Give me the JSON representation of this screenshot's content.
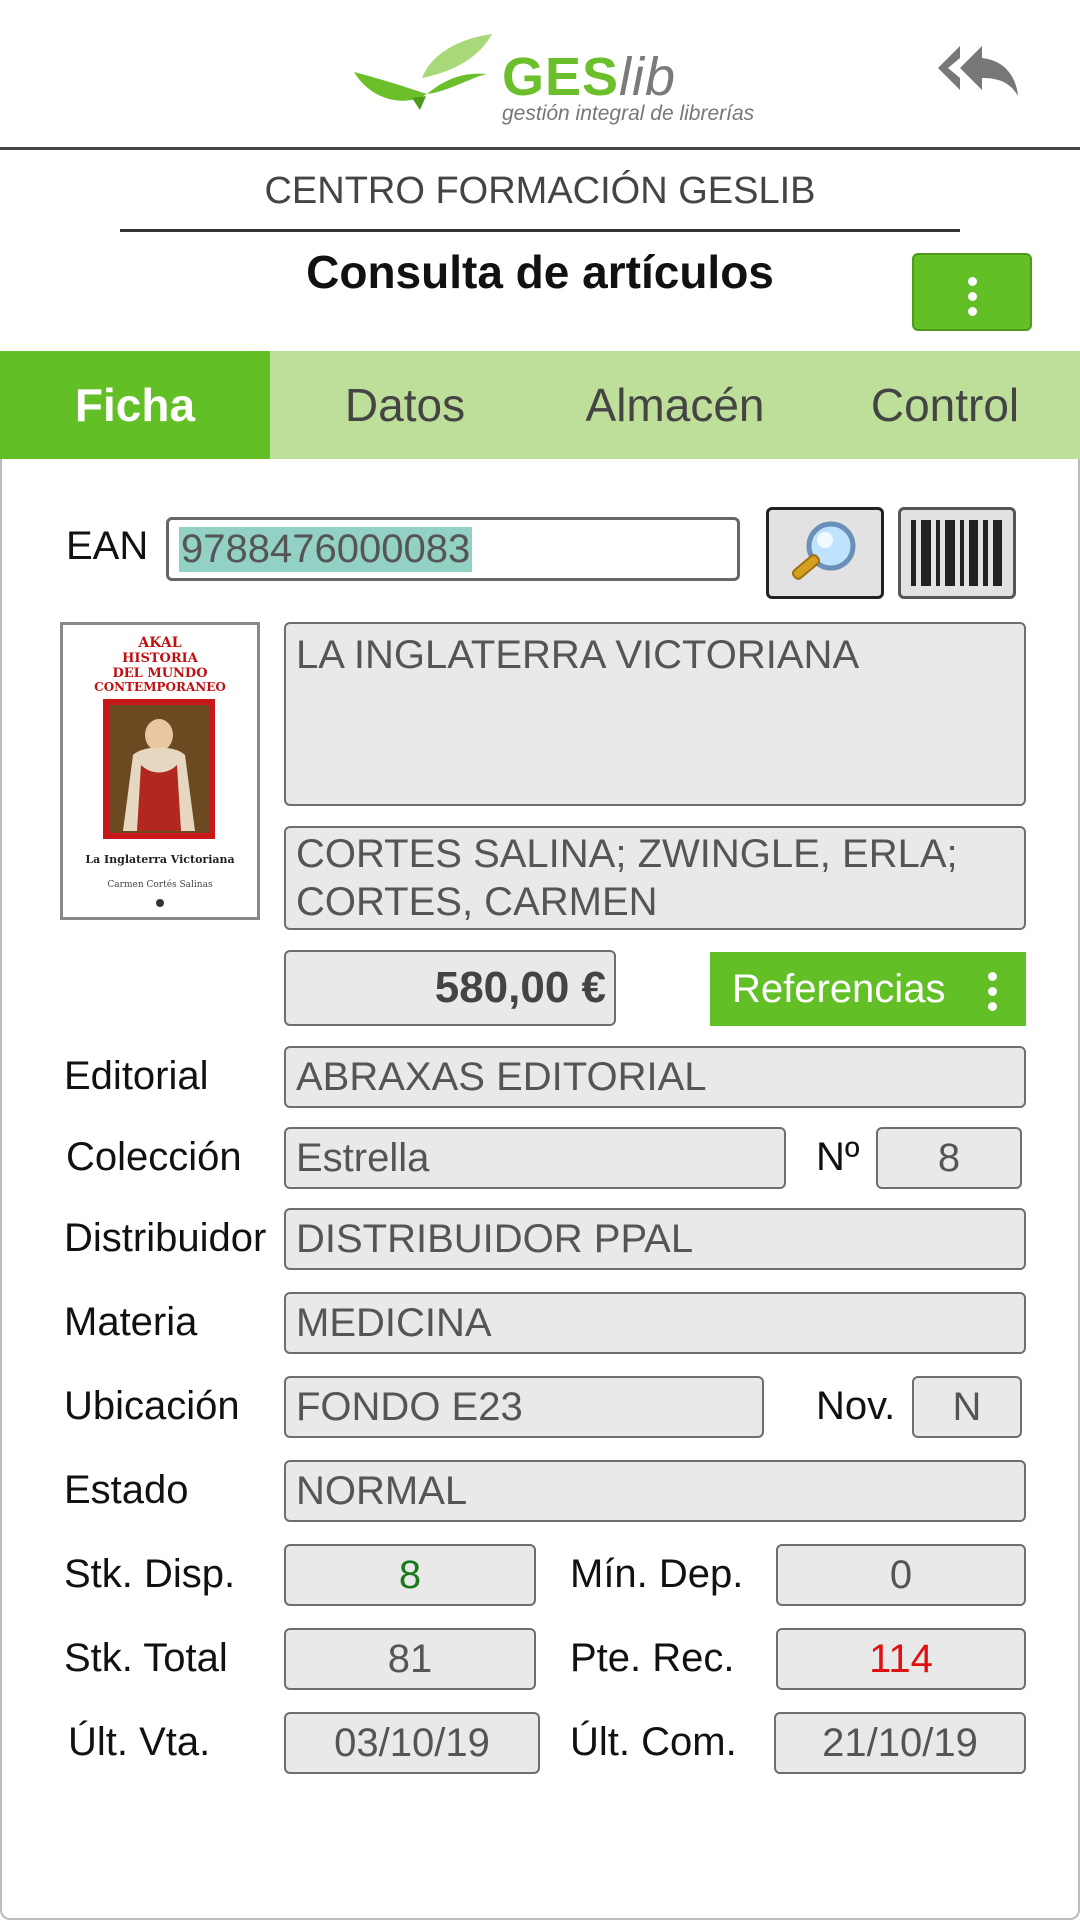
{
  "header": {
    "logo_word_a": "GES",
    "logo_word_b": "lib",
    "logo_tagline": "gestión integral de librerías",
    "center_name": "CENTRO FORMACIÓN GESLIB",
    "page_title": "Consulta de artículos"
  },
  "tabs": [
    {
      "label": "Ficha",
      "active": true
    },
    {
      "label": "Datos",
      "active": false
    },
    {
      "label": "Almacén",
      "active": false
    },
    {
      "label": "Control",
      "active": false
    }
  ],
  "form": {
    "ean_label": "EAN",
    "ean_value": "9788476000083",
    "title": "LA INGLATERRA VICTORIANA",
    "author": "CORTES SALINA; ZWINGLE, ERLA; CORTES, CARMEN",
    "price": "580,00 €",
    "referencias_label": "Referencias",
    "editorial_label": "Editorial",
    "editorial_value": "ABRAXAS EDITORIAL",
    "coleccion_label": "Colección",
    "coleccion_value": "Estrella",
    "numero_label": "Nº",
    "numero_value": "8",
    "distribuidor_label": "Distribuidor",
    "distribuidor_value": "DISTRIBUIDOR PPAL",
    "materia_label": "Materia",
    "materia_value": "MEDICINA",
    "ubicacion_label": "Ubicación",
    "ubicacion_value": "FONDO E23",
    "nov_label": "Nov.",
    "nov_value": "N",
    "estado_label": "Estado",
    "estado_value": "NORMAL",
    "stk_disp_label": "Stk. Disp.",
    "stk_disp_value": "8",
    "min_dep_label": "Mín. Dep.",
    "min_dep_value": "0",
    "stk_total_label": "Stk. Total",
    "stk_total_value": "81",
    "pte_rec_label": "Pte. Rec.",
    "pte_rec_value": "114",
    "ult_vta_label": "Últ. Vta.",
    "ult_vta_value": "03/10/19",
    "ult_com_label": "Últ. Com.",
    "ult_com_value": "21/10/19"
  },
  "cover": {
    "top_text_1": "AKAL",
    "top_text_2": "HISTORIA",
    "top_text_3": "DEL MUNDO",
    "top_text_4": "CONTEMPORANEO",
    "book_title": "La Inglaterra Victoriana",
    "book_author": "Carmen Cortés Salinas"
  },
  "colors": {
    "accent_green": "#62bf26",
    "tab_bar": "#bedf9a",
    "stock_green": "#1a7a1a",
    "pending_red": "#e01010"
  },
  "icons": {
    "back": "reply-all-icon",
    "menu": "kebab-menu-icon",
    "search": "magnifier-icon",
    "barcode": "barcode-icon"
  }
}
